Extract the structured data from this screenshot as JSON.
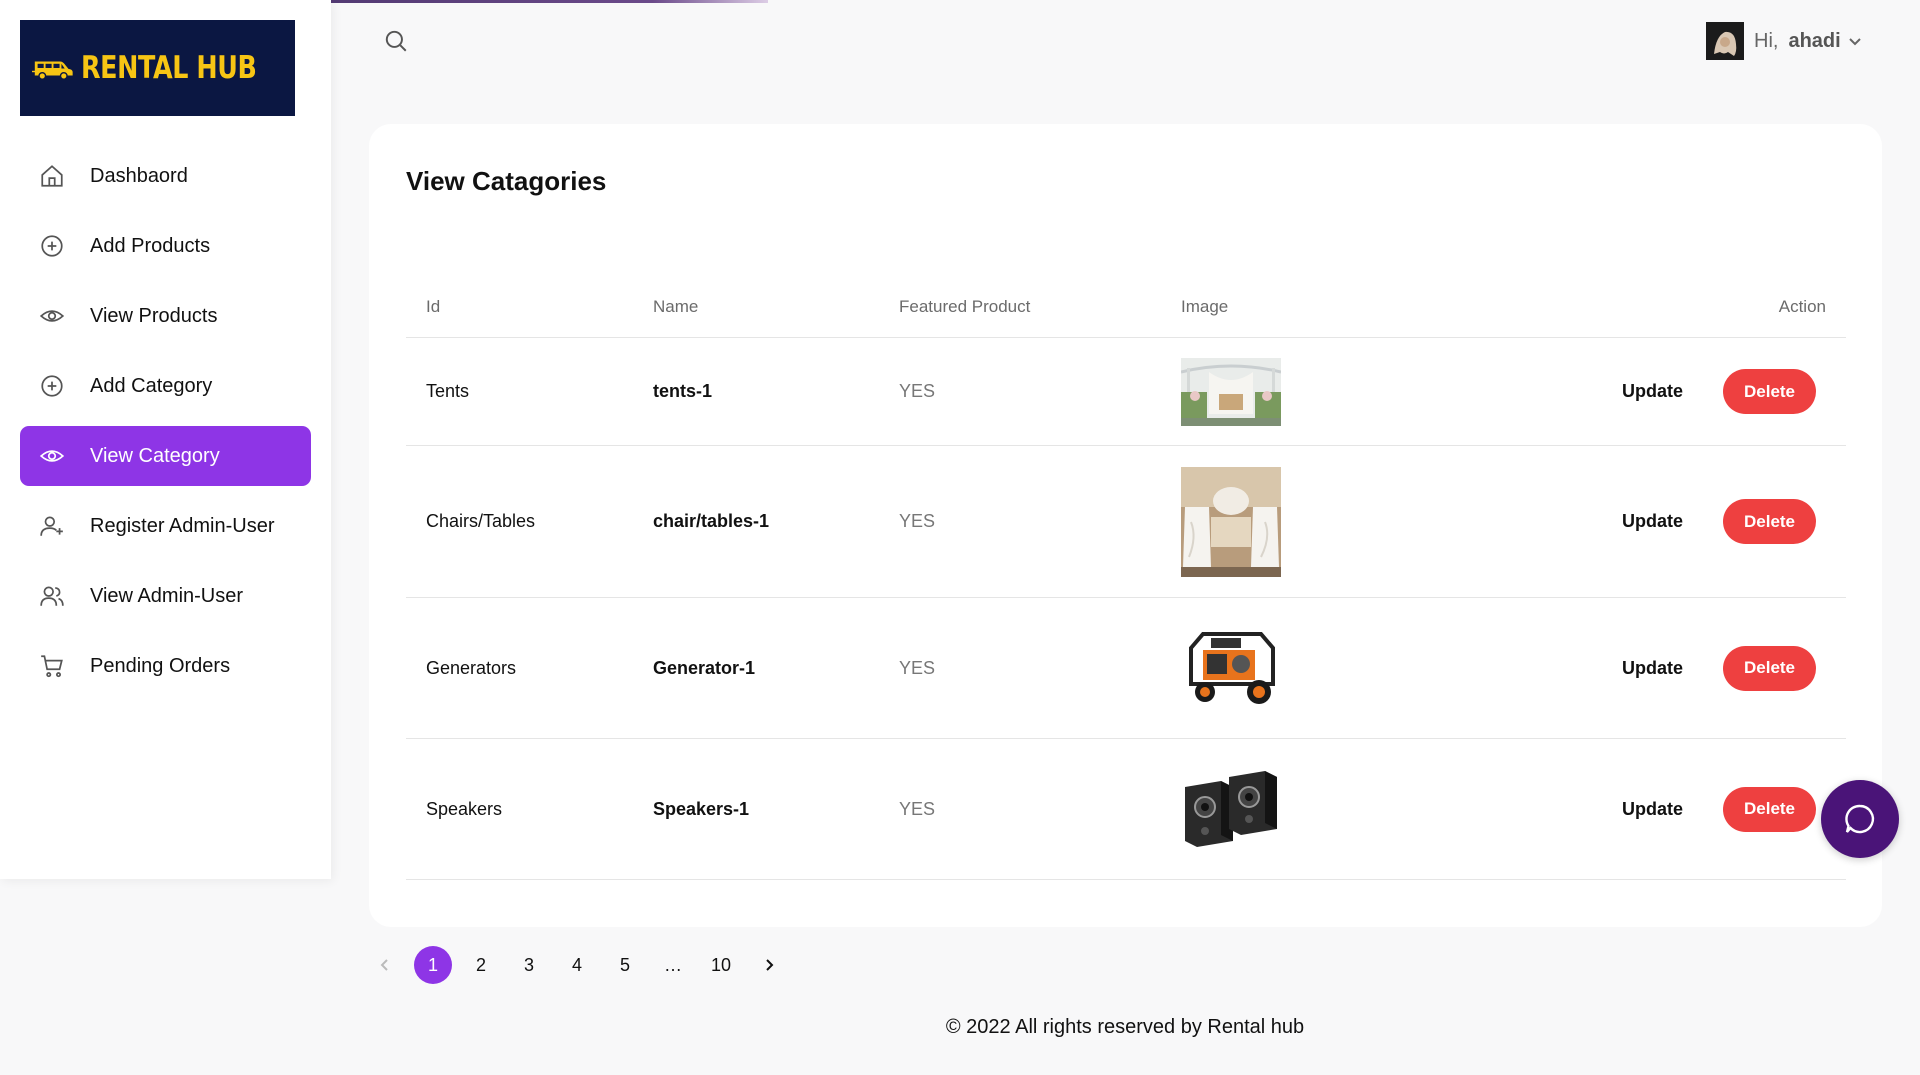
{
  "brand": {
    "logo_text": "RENTAL HUB"
  },
  "sidebar": {
    "items": [
      {
        "label": "Dashbaord",
        "icon": "home-icon"
      },
      {
        "label": "Add Products",
        "icon": "plus-circle-icon"
      },
      {
        "label": "View Products",
        "icon": "eye-icon"
      },
      {
        "label": "Add Category",
        "icon": "plus-circle-icon"
      },
      {
        "label": "View Category",
        "icon": "eye-icon",
        "active": true
      },
      {
        "label": "Register Admin-User",
        "icon": "user-plus-icon"
      },
      {
        "label": "View Admin-User",
        "icon": "users-icon"
      },
      {
        "label": "Pending Orders",
        "icon": "cart-icon"
      }
    ]
  },
  "header": {
    "greeting": "Hi,",
    "username": "ahadi"
  },
  "page": {
    "title": "View Catagories"
  },
  "table": {
    "columns": [
      "Id",
      "Name",
      "Featured Product",
      "Image",
      "Action"
    ],
    "rows": [
      {
        "id": "Tents",
        "name": "tents-1",
        "featured": "YES",
        "image": "tent-photo"
      },
      {
        "id": "Chairs/Tables",
        "name": "chair/tables-1",
        "featured": "YES",
        "image": "chairs-photo"
      },
      {
        "id": "Generators",
        "name": "Generator-1",
        "featured": "YES",
        "image": "generator-photo"
      },
      {
        "id": "Speakers",
        "name": "Speakers-1",
        "featured": "YES",
        "image": "speakers-photo"
      }
    ],
    "update_label": "Update",
    "delete_label": "Delete"
  },
  "pagination": {
    "pages": [
      "1",
      "2",
      "3",
      "4",
      "5",
      "…",
      "10"
    ],
    "current": "1"
  },
  "footer": {
    "text": "© 2022 All rights reserved by Rental hub"
  },
  "colors": {
    "accent": "#8e35e6",
    "danger": "#ee4040",
    "logo_bg": "#0b1742",
    "logo_text": "#f7c514",
    "chat": "#4a1478"
  }
}
